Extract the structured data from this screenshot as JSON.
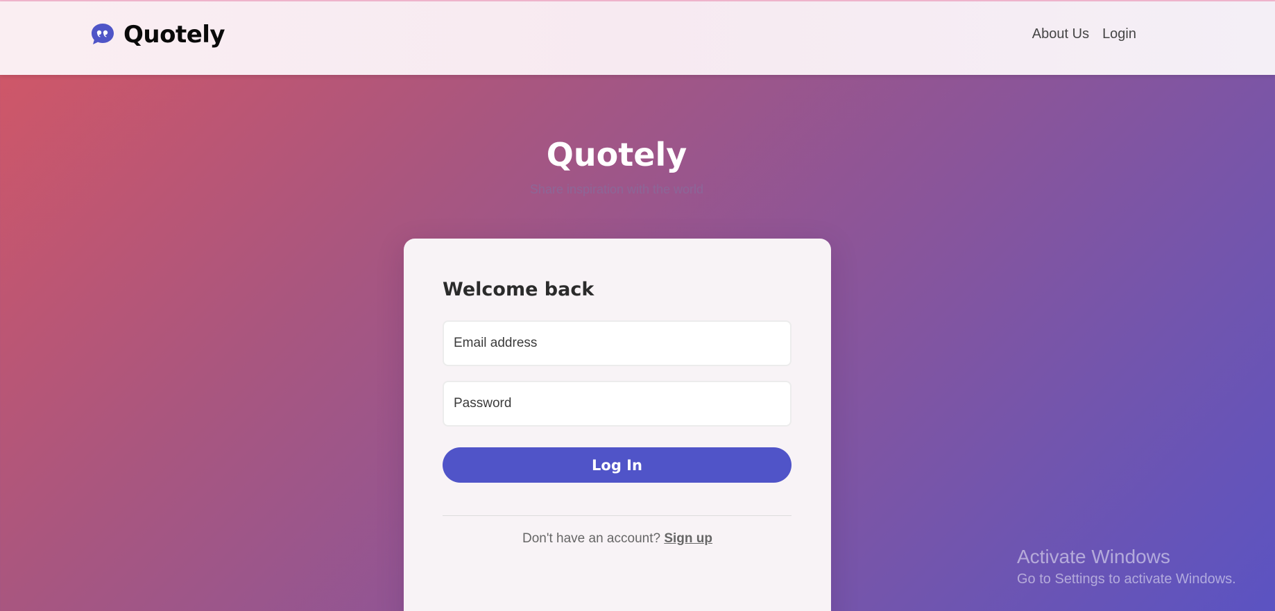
{
  "app": {
    "brand_name": "Quotely",
    "brand_icon": "quote-bubble-icon",
    "accent_color": "#5054c8"
  },
  "nav": {
    "links": [
      {
        "label": "About Us"
      },
      {
        "label": "Login"
      }
    ]
  },
  "hero": {
    "title": "Quotely",
    "subtitle": "Share inspiration with the world"
  },
  "login_card": {
    "title": "Welcome back",
    "email_placeholder": "Email address",
    "password_placeholder": "Password",
    "submit_label": "Log In",
    "signup_prompt": "Don't have an account? ",
    "signup_link": "Sign up"
  },
  "os_watermark": {
    "title": "Activate Windows",
    "subtitle": "Go to Settings to activate Windows."
  }
}
